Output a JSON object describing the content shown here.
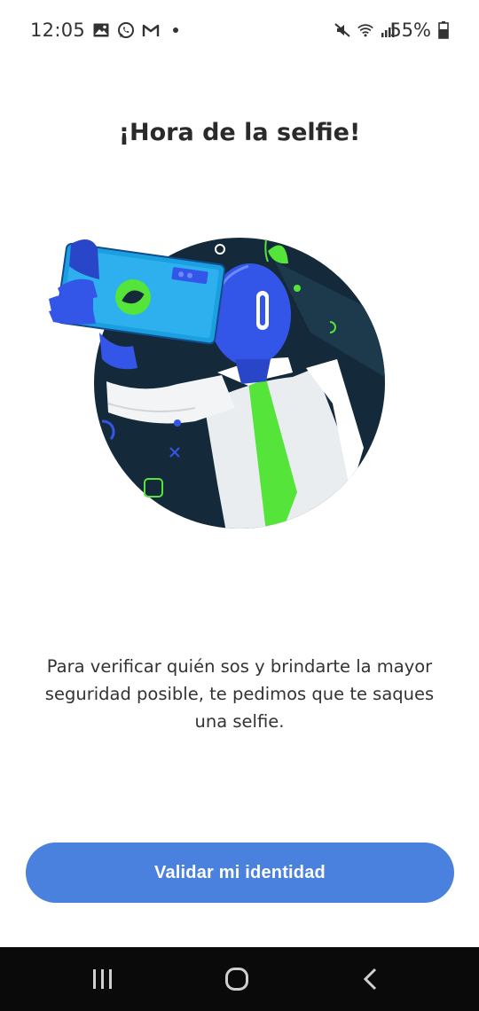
{
  "status_bar": {
    "time": "12:05",
    "left_icons": [
      "image-icon",
      "whatsapp-icon",
      "gmail-icon",
      "dot-icon"
    ],
    "right_icons": [
      "mute-icon",
      "wifi-icon",
      "signal-icon"
    ],
    "battery_percent": "55%"
  },
  "screen": {
    "title": "¡Hora de la selfie!",
    "description": "Para verificar quién sos y brindarte la mayor seguridad posible, te pedimos que te saques una selfie.",
    "button_label": "Validar mi identidad"
  },
  "colors": {
    "accent": "#4a80de",
    "illustration_bg": "#142a3b",
    "character_blue": "#3456e8",
    "tie_green": "#55e43a"
  },
  "nav_bar": {
    "buttons": [
      "recent-apps-icon",
      "home-icon",
      "back-icon"
    ]
  }
}
